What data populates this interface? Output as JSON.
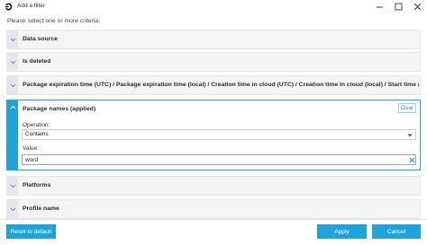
{
  "window": {
    "title": "Add a filter"
  },
  "prompt": "Please select one or more criteria:",
  "criteria": [
    {
      "label": "Data source"
    },
    {
      "label": "Is deleted"
    },
    {
      "label": "Package expiration time (UTC) / Package expiration time (local) / Creation time in cloud (UTC) / Creation time in cloud (local) / Start time (UTC) /..."
    }
  ],
  "expanded": {
    "label": "Package names (applied)",
    "clear_label": "Clear",
    "operation_label": "Operation:",
    "operation_value": "Contains",
    "value_label": "Value:",
    "value_text": "word"
  },
  "criteria_after": [
    {
      "label": "Platforms"
    },
    {
      "label": "Profile name"
    }
  ],
  "footer": {
    "reset_label": "Reset to default",
    "apply_label": "Apply",
    "cancel_label": "Cancel"
  },
  "colors": {
    "accent": "#1ea4d9"
  }
}
